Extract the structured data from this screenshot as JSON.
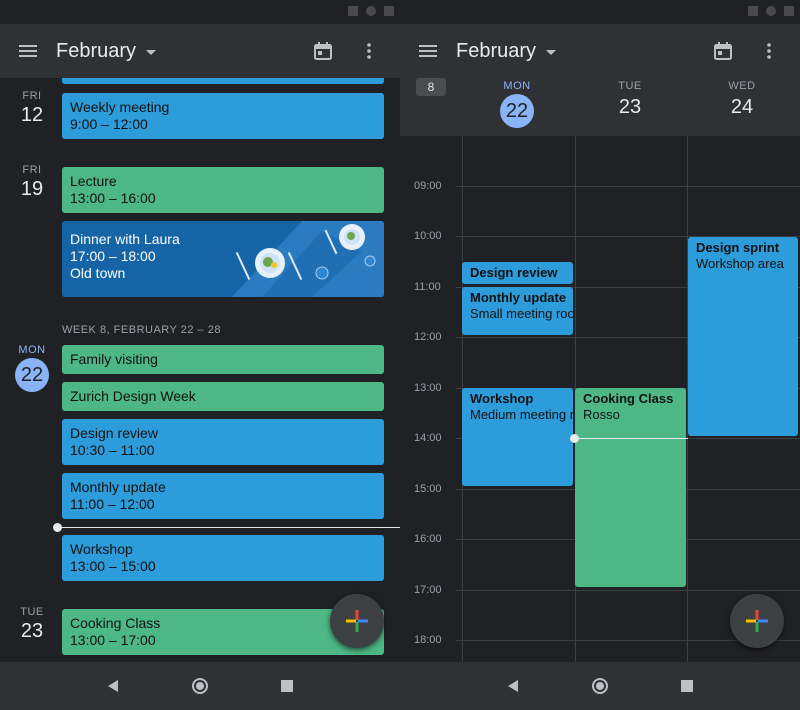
{
  "left": {
    "month_title": "February",
    "week_header": "WEEK 8, FEBRUARY 22 – 28",
    "days": [
      {
        "dow": "FRI",
        "num": "12"
      },
      {
        "dow": "FRI",
        "num": "19"
      },
      {
        "dow": "MON",
        "num": "22"
      },
      {
        "dow": "TUE",
        "num": "23"
      }
    ],
    "events": [
      {
        "title": "Weekly meeting",
        "sub": "9:00 – 12:00"
      },
      {
        "title": "Lecture",
        "sub": "13:00 – 16:00"
      },
      {
        "title": "Dinner with Laura",
        "sub": "17:00 – 18:00",
        "sub2": "Old town"
      },
      {
        "title": "Family visiting"
      },
      {
        "title": "Zurich Design Week"
      },
      {
        "title": "Design review",
        "sub": "10:30 – 11:00"
      },
      {
        "title": "Monthly update",
        "sub": "11:00 – 12:00"
      },
      {
        "title": "Workshop",
        "sub": "13:00 – 15:00"
      },
      {
        "title": "Cooking Class",
        "sub": "13:00 – 17:00"
      }
    ]
  },
  "right": {
    "month_title": "February",
    "week_number": "8",
    "columns": [
      {
        "dow": "MON",
        "num": "22"
      },
      {
        "dow": "TUE",
        "num": "23"
      },
      {
        "dow": "WED",
        "num": "24"
      }
    ],
    "hours": [
      "09:00",
      "10:00",
      "11:00",
      "12:00",
      "13:00",
      "14:00",
      "15:00",
      "16:00",
      "17:00",
      "18:00"
    ],
    "events": [
      {
        "title": "Design review",
        "sub": ""
      },
      {
        "title": "Monthly update",
        "sub": "Small meeting room"
      },
      {
        "title": "Workshop",
        "sub": "Medium meeting room"
      },
      {
        "title": "Cooking Class",
        "sub": "Rosso"
      },
      {
        "title": "Design sprint",
        "sub": "Workshop area"
      }
    ]
  },
  "colors": {
    "background": "#202124",
    "appbar": "#303134",
    "event_blue": "#2d9cdb",
    "event_green": "#4db886",
    "today_accent": "#8ab4f8"
  },
  "icons": [
    "menu-icon",
    "calendar-today-icon",
    "more-vert-icon",
    "add-icon",
    "back-icon",
    "home-icon",
    "recents-icon"
  ]
}
